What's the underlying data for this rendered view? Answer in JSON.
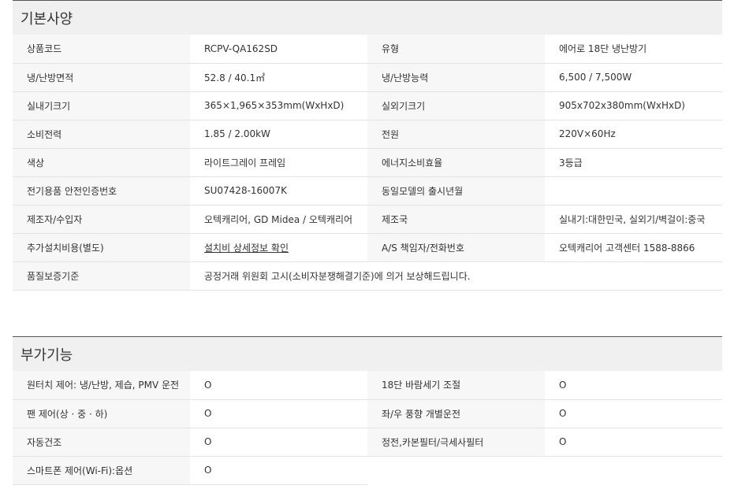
{
  "basic": {
    "title": "기본사양",
    "rows": [
      {
        "l1": "상품코드",
        "v1": "RCPV-QA162SD",
        "l2": "유형",
        "v2": "에어로 18단 냉난방기"
      },
      {
        "l1": "냉/난방면적",
        "v1": "52.8 / 40.1㎡",
        "l2": "냉/난방능력",
        "v2": "6,500 / 7,500W"
      },
      {
        "l1": "실내기크기",
        "v1": "365×1,965×353mm(WxHxD)",
        "l2": "실외기크기",
        "v2": "905x702x380mm(WxHxD)"
      },
      {
        "l1": "소비전력",
        "v1": "1.85 / 2.00kW",
        "l2": "전원",
        "v2": "220V×60Hz"
      },
      {
        "l1": "색상",
        "v1": "라이트그레이 프레임",
        "l2": "에너지소비효율",
        "v2": "3등급"
      },
      {
        "l1": "전기용품 안전인증번호",
        "v1": "SU07428-16007K",
        "l2": "동일모델의 출시년월",
        "v2": ""
      },
      {
        "l1": "제조자/수입자",
        "v1": "오텍캐리어, GD Midea / 오텍캐리어",
        "l2": "제조국",
        "v2": "실내기:대한민국, 실외기/벽걸이:중국"
      },
      {
        "l1": "추가설치비용(별도)",
        "v1": "설치비 상세정보 확인",
        "l2": "A/S 책임자/전화번호",
        "v2": "오텍캐리어 고객센터 1588-8866"
      }
    ],
    "warranty_label": "품질보증기준",
    "warranty_value": "공정거래 위원회 고시(소비자분쟁해결기준)에 의거 보상해드립니다."
  },
  "extra": {
    "title": "부가기능",
    "rows": [
      {
        "l1": "원터치 제어: 냉/난방, 제습, PMV 운전",
        "v1": "O",
        "l2": "18단 바람세기 조절",
        "v2": "O"
      },
      {
        "l1": "팬 제어(상 · 중 · 하)",
        "v1": "O",
        "l2": "좌/우 풍향 개별운전",
        "v2": "O"
      },
      {
        "l1": "자동건조",
        "v1": "O",
        "l2": "정전,카본필터/극세사필터",
        "v2": "O"
      }
    ],
    "last_label": "스마트폰 제어(Wi-Fi):옵션",
    "last_value": "O"
  }
}
